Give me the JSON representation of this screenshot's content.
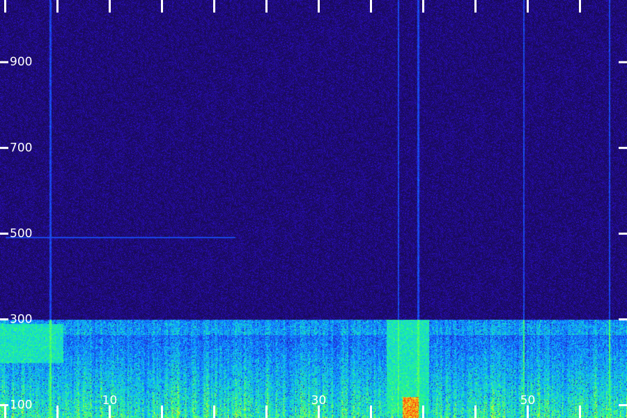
{
  "chart_data": {
    "type": "heatmap",
    "title": "",
    "xlabel": "",
    "ylabel": "",
    "x_ticks": [
      0,
      5,
      10,
      15,
      20,
      25,
      30,
      35,
      40,
      45,
      50,
      55
    ],
    "x_tick_labels": [
      {
        "value": 10,
        "text": "10"
      },
      {
        "value": 30,
        "text": "30"
      },
      {
        "value": 50,
        "text": "50"
      }
    ],
    "xlim": [
      -0.5,
      59.5
    ],
    "y_ticks": [
      100,
      300,
      500,
      700,
      900
    ],
    "y_tick_labels": [
      "100",
      "300",
      "500",
      "700",
      "900"
    ],
    "ylim": [
      70,
      1045
    ],
    "grid": false,
    "colormap": [
      "#150a40",
      "#2a0cc0",
      "#1060ff",
      "#10c0ff",
      "#20ff80",
      "#e0ff20",
      "#ff8010",
      "#ff1010"
    ],
    "bands": [
      {
        "y": [
          70,
          300
        ],
        "level": "high"
      },
      {
        "y": [
          300,
          1045
        ],
        "level": "low"
      }
    ],
    "horizontal_line": {
      "y": 492,
      "x": [
        0,
        22
      ]
    },
    "vertical_lines": [
      {
        "x": 4.3,
        "level": "medium"
      },
      {
        "x": 37.6,
        "level": "medium"
      },
      {
        "x": 39.5,
        "level": "medium"
      },
      {
        "x": 49.6,
        "level": "medium"
      },
      {
        "x": 57.8,
        "level": "medium"
      }
    ],
    "hot_regions": [
      {
        "x": [
          -0.5,
          5.5
        ],
        "y": [
          200,
          290
        ],
        "level": "high"
      },
      {
        "x": [
          36.5,
          40.5
        ],
        "y": [
          80,
          300
        ],
        "level": "high"
      },
      {
        "x": [
          38,
          39.5
        ],
        "y": [
          70,
          120
        ],
        "level": "peak"
      }
    ]
  }
}
